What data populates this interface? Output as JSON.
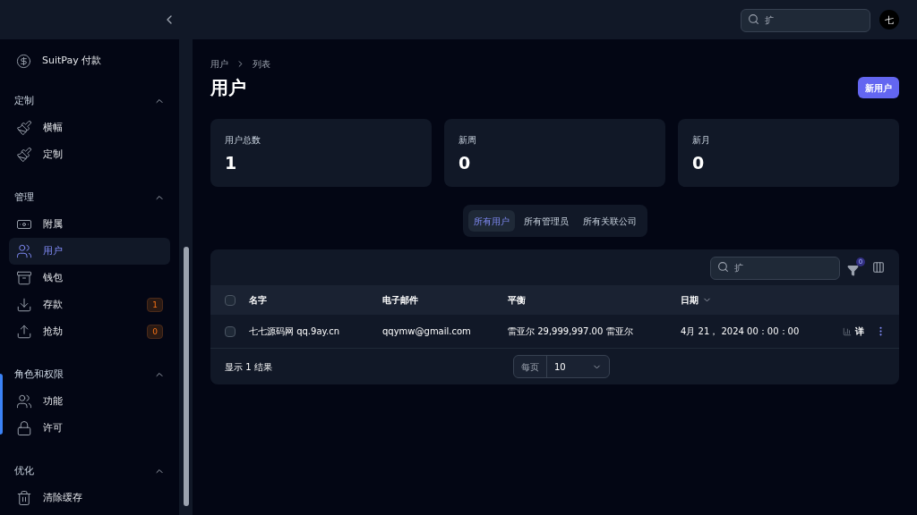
{
  "topbar": {
    "search": {
      "placeholder": "扩"
    },
    "avatar": "七"
  },
  "sidebar": {
    "top_item": {
      "label": "SuitPay 付款",
      "selected": false
    },
    "groups": [
      {
        "label": "定制",
        "expanded": true,
        "items": [
          {
            "label": "横幅",
            "selected": false
          },
          {
            "label": "定制",
            "selected": false
          }
        ]
      },
      {
        "label": "管理",
        "expanded": true,
        "items": [
          {
            "label": "附属",
            "selected": false
          },
          {
            "label": "用户",
            "selected": true
          },
          {
            "label": "钱包",
            "selected": false
          },
          {
            "label": "存款",
            "selected": false,
            "badge": "1"
          },
          {
            "label": "抢劫",
            "selected": false,
            "badge": "0"
          }
        ]
      },
      {
        "label": "角色和权限",
        "expanded": true,
        "items": [
          {
            "label": "功能",
            "selected": false
          },
          {
            "label": "许可",
            "selected": false
          }
        ]
      },
      {
        "label": "优化",
        "expanded": true,
        "items": [
          {
            "label": "清除缓存",
            "selected": false
          }
        ]
      }
    ]
  },
  "breadcrumb": [
    "用户",
    "列表"
  ],
  "page_title": "用户",
  "new_button": "新用户",
  "stats": [
    {
      "label": "用户总数",
      "value": "1"
    },
    {
      "label": "新周",
      "value": "0"
    },
    {
      "label": "新月",
      "value": "0"
    }
  ],
  "tabs": [
    {
      "label": "所有用户",
      "selected": true
    },
    {
      "label": "所有管理员",
      "selected": false
    },
    {
      "label": "所有关联公司",
      "selected": false
    }
  ],
  "table": {
    "search": {
      "placeholder": "扩"
    },
    "filter_count": "0",
    "select_all_checked": false,
    "columns": [
      "名字",
      "电子邮件",
      "平衡",
      "日期"
    ],
    "rows": [
      {
        "checked": false,
        "cells": [
          "七七源码网 qq.9ay.cn",
          "qqymw@gmail.com",
          "雷亚尔 29,999,997.00 雷亚尔",
          "4月 21， 2024 00：00：00"
        ],
        "action": "详"
      }
    ],
    "summary": "显示 1 结果",
    "per_page_label": "每页",
    "per_page": "10"
  }
}
